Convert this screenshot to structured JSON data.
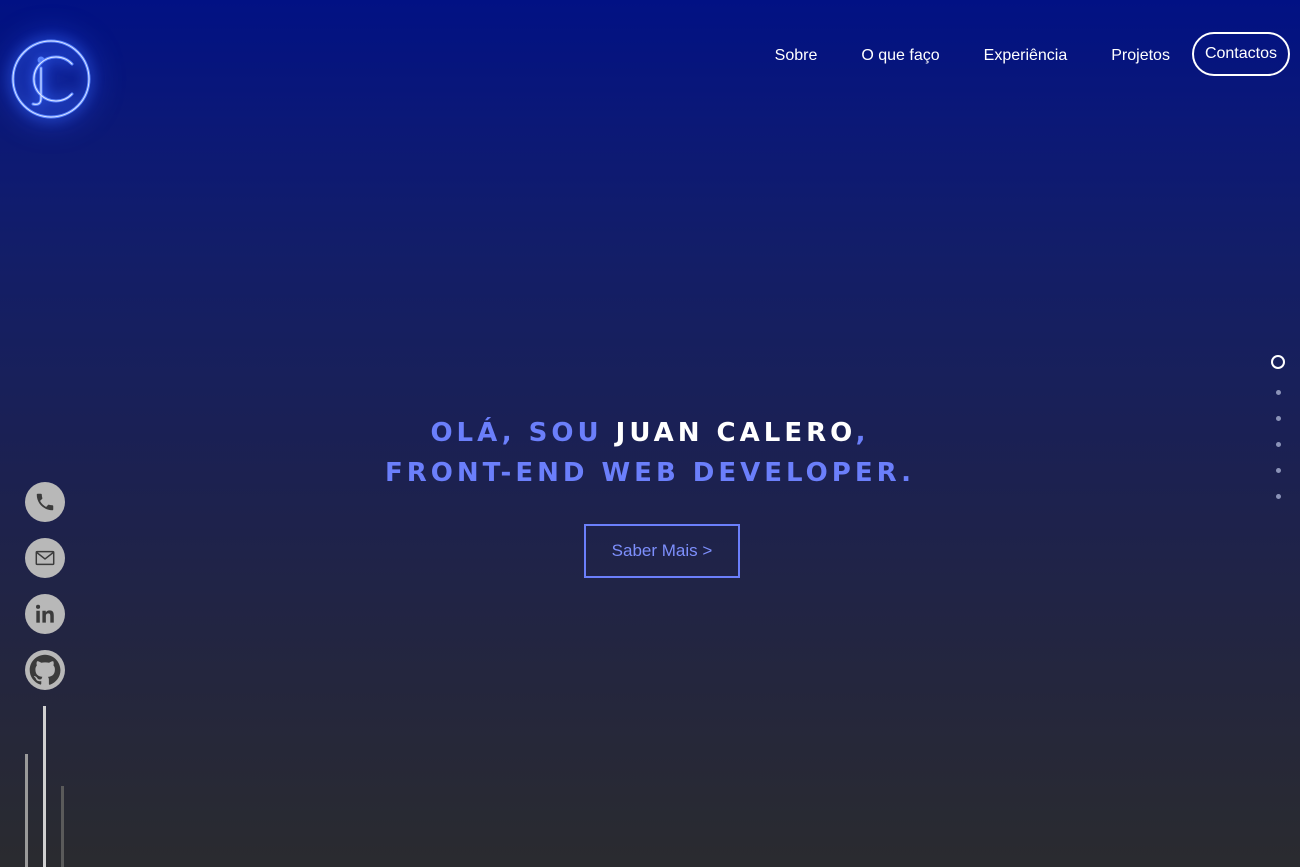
{
  "logo": {
    "text": "jC",
    "icon": "jc-logo-icon",
    "glow_color": "#3a6dff"
  },
  "nav": {
    "items": [
      "Sobre",
      "O que faço",
      "Experiência",
      "Projetos"
    ],
    "contact_label": "Contactos"
  },
  "hero": {
    "greeting": "OLÁ, SOU ",
    "name": "JUAN CALERO",
    "comma": ",",
    "role": "FRONT-END WEB DEVELOPER.",
    "cta_label": "Saber Mais >",
    "accent_color": "#6b7ffb"
  },
  "scroll_indicator": {
    "active_index": 0,
    "total": 6
  },
  "social": [
    {
      "name": "phone",
      "icon": "phone-icon"
    },
    {
      "name": "email",
      "icon": "mail-icon"
    },
    {
      "name": "linkedin",
      "icon": "linkedin-icon"
    },
    {
      "name": "github",
      "icon": "github-icon"
    }
  ]
}
